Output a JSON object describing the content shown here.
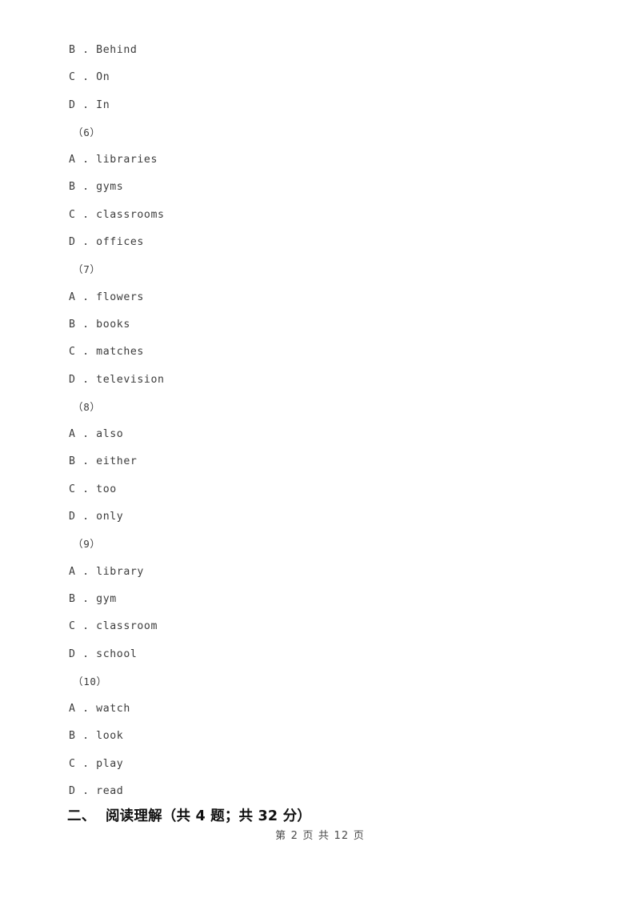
{
  "document": {
    "body_lines": [
      {
        "kind": "option",
        "text": "B . Behind"
      },
      {
        "kind": "option",
        "text": "C . On"
      },
      {
        "kind": "option",
        "text": "D . In"
      },
      {
        "kind": "qnum",
        "text": "（6）"
      },
      {
        "kind": "option",
        "text": "A . libraries"
      },
      {
        "kind": "option",
        "text": "B . gyms"
      },
      {
        "kind": "option",
        "text": "C . classrooms"
      },
      {
        "kind": "option",
        "text": "D . offices"
      },
      {
        "kind": "qnum",
        "text": "（7）"
      },
      {
        "kind": "option",
        "text": "A . flowers"
      },
      {
        "kind": "option",
        "text": "B . books"
      },
      {
        "kind": "option",
        "text": "C . matches"
      },
      {
        "kind": "option",
        "text": "D . television"
      },
      {
        "kind": "qnum",
        "text": "（8）"
      },
      {
        "kind": "option",
        "text": "A . also"
      },
      {
        "kind": "option",
        "text": "B . either"
      },
      {
        "kind": "option",
        "text": "C . too"
      },
      {
        "kind": "option",
        "text": "D . only"
      },
      {
        "kind": "qnum",
        "text": "（9）"
      },
      {
        "kind": "option",
        "text": "A . library"
      },
      {
        "kind": "option",
        "text": "B . gym"
      },
      {
        "kind": "option",
        "text": "C . classroom"
      },
      {
        "kind": "option",
        "text": "D . school"
      },
      {
        "kind": "qnum",
        "text": "（10）"
      },
      {
        "kind": "option",
        "text": "A . watch"
      },
      {
        "kind": "option",
        "text": "B . look"
      },
      {
        "kind": "option",
        "text": "C . play"
      },
      {
        "kind": "option",
        "text": "D . read"
      }
    ],
    "section_heading": "二、  阅读理解（共 4 题；共 32 分）",
    "footer": "第 2 页 共 12 页"
  }
}
